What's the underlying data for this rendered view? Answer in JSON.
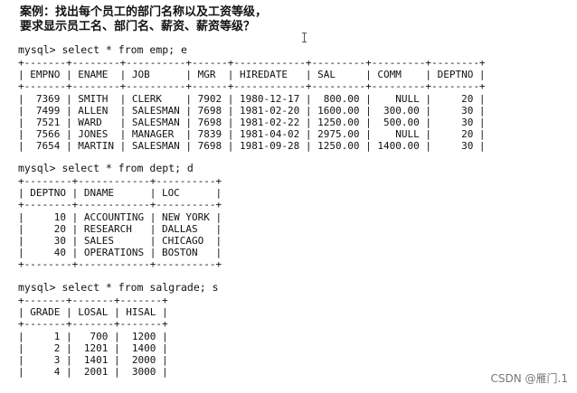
{
  "title": {
    "line1": "案例：找出每个员工的部门名称以及工资等级，",
    "line2": "要求显示员工名、部门名、薪资、薪资等级？"
  },
  "queries": [
    {
      "command": "mysql> select * from emp; e",
      "table": "+-------+--------+----------+------+------------+---------+---------+--------+\n| EMPNO | ENAME  | JOB      | MGR  | HIREDATE   | SAL     | COMM    | DEPTNO |\n+-------+--------+----------+------+------------+---------+---------+--------+\n|  7369 | SMITH  | CLERK    | 7902 | 1980-12-17 |  800.00 |    NULL |     20 |\n|  7499 | ALLEN  | SALESMAN | 7698 | 1981-02-20 | 1600.00 |  300.00 |     30 |\n|  7521 | WARD   | SALESMAN | 7698 | 1981-02-22 | 1250.00 |  500.00 |     30 |\n|  7566 | JONES  | MANAGER  | 7839 | 1981-04-02 | 2975.00 |    NULL |     20 |\n|  7654 | MARTIN | SALESMAN | 7698 | 1981-09-28 | 1250.00 | 1400.00 |     30 |"
    },
    {
      "command": "mysql> select * from dept; d",
      "table": "+--------+------------+----------+\n| DEPTNO | DNAME      | LOC      |\n+--------+------------+----------+\n|     10 | ACCOUNTING | NEW YORK |\n|     20 | RESEARCH   | DALLAS   |\n|     30 | SALES      | CHICAGO  |\n|     40 | OPERATIONS | BOSTON   |\n+--------+------------+----------+"
    },
    {
      "command": "mysql> select * from salgrade; s",
      "table": "+-------+-------+-------+\n| GRADE | LOSAL | HISAL |\n+-------+-------+-------+\n|     1 |   700 |  1200 |\n|     2 |  1201 |  1400 |\n|     3 |  1401 |  2000 |\n|     4 |  2001 |  3000 |"
    }
  ],
  "watermark": "CSDN @雁门.1"
}
